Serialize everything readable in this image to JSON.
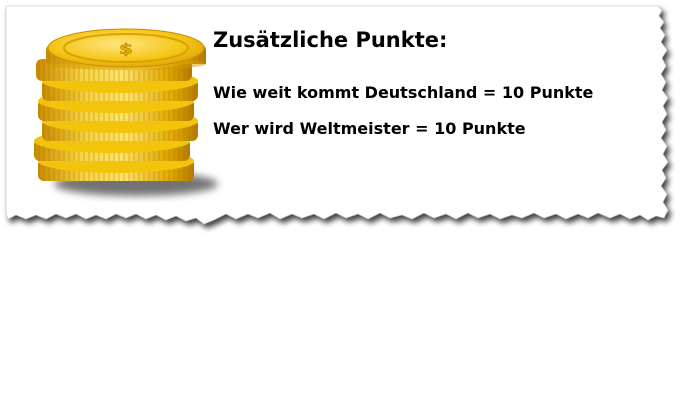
{
  "card": {
    "title": "Zusätzliche Punkte:",
    "lines": [
      "Wie weit kommt Deutschland = 10 Punkte",
      "Wer wird Weltmeister = 10 Punkte"
    ],
    "image": {
      "icon": "gold-coin-stack-icon",
      "colors": {
        "gold": "#f2c40c",
        "gold_dark": "#c98c00",
        "gold_light": "#ffe36b"
      }
    }
  }
}
